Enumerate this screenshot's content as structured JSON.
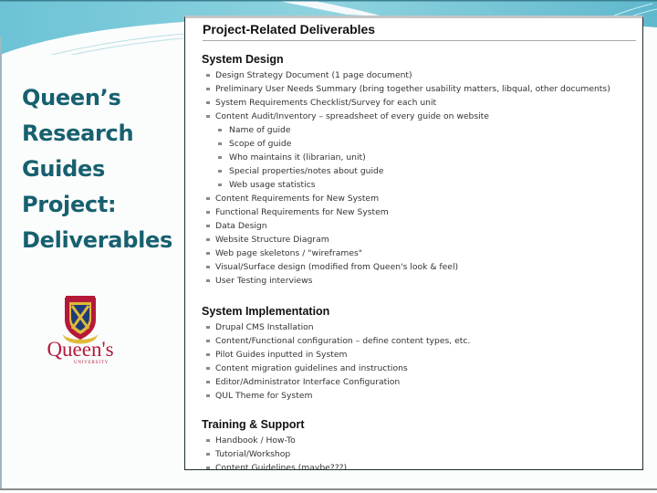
{
  "slide": {
    "title_lines": [
      "Queen’s",
      "Research",
      "Guides",
      "Project:",
      "Deliverables"
    ],
    "logo": {
      "icon": "queens-university-crest",
      "wordmark": "Queen's",
      "subtext": "UNIVERSITY"
    },
    "colors": {
      "title": "#17606f",
      "band_light": "#8fd3df",
      "band_dark": "#4aa9c0",
      "crest_red": "#b5193a",
      "crest_gold": "#e0b93a",
      "crest_blue": "#1e3c78"
    }
  },
  "panel": {
    "title": "Project-Related Deliverables",
    "sections": [
      {
        "heading": "System Design",
        "items": [
          {
            "text": "Design Strategy Document (1 page document)",
            "level": 1
          },
          {
            "text": "Preliminary User Needs Summary (bring together usability matters, libqual, other documents)",
            "level": 1
          },
          {
            "text": "System Requirements Checklist/Survey for each unit",
            "level": 1
          },
          {
            "text": "Content Audit/Inventory – spreadsheet of every guide on website",
            "level": 1
          },
          {
            "text": "Name of guide",
            "level": 2
          },
          {
            "text": "Scope of guide",
            "level": 2
          },
          {
            "text": "Who maintains it (librarian, unit)",
            "level": 2
          },
          {
            "text": "Special properties/notes about guide",
            "level": 2
          },
          {
            "text": "Web usage statistics",
            "level": 2
          },
          {
            "text": "Content Requirements for New System",
            "level": 1
          },
          {
            "text": "Functional Requirements for New System",
            "level": 1
          },
          {
            "text": "Data Design",
            "level": 1
          },
          {
            "text": "Website Structure Diagram",
            "level": 1
          },
          {
            "text": "Web page skeletons / \"wireframes\"",
            "level": 1
          },
          {
            "text": "Visual/Surface design (modified from Queen's look & feel)",
            "level": 1
          },
          {
            "text": "User Testing interviews",
            "level": 1
          }
        ]
      },
      {
        "heading": "System Implementation",
        "items": [
          {
            "text": "Drupal CMS Installation",
            "level": 1
          },
          {
            "text": "Content/Functional configuration – define content types, etc.",
            "level": 1
          },
          {
            "text": "Pilot Guides inputted in System",
            "level": 1
          },
          {
            "text": "Content migration guidelines and instructions",
            "level": 1
          },
          {
            "text": "Editor/Administrator Interface Configuration",
            "level": 1
          },
          {
            "text": "QUL Theme for System",
            "level": 1
          }
        ]
      },
      {
        "heading": "Training & Support",
        "items": [
          {
            "text": "Handbook / How-To",
            "level": 1
          },
          {
            "text": "Tutorial/Workshop",
            "level": 1
          },
          {
            "text": "Content Guidelines (maybe???)",
            "level": 1
          }
        ]
      }
    ]
  }
}
